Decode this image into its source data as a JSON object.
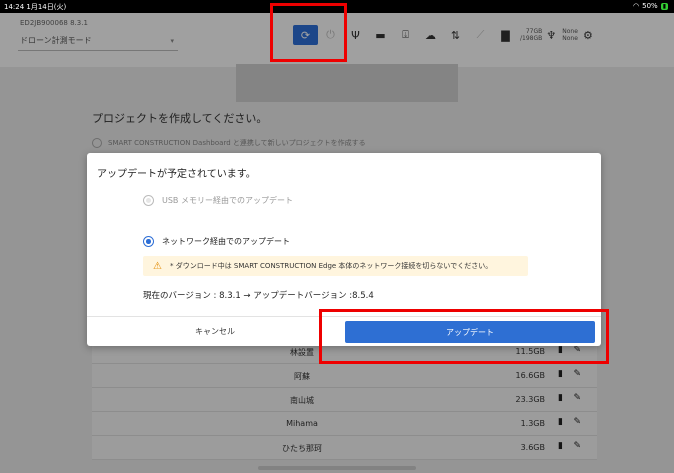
{
  "status_bar": {
    "time": "14:24  1月14日(火)",
    "dots": "•••",
    "battery": "50%"
  },
  "header": {
    "device_id": "ED2JB900068   8.3.1",
    "mode_label": "ドローン計測モード",
    "storage_used": "77GB",
    "storage_total": "/198GB",
    "none_label_1": "None",
    "none_label_2": "None"
  },
  "page": {
    "prompt": "プロジェクトを作成してください。",
    "dashboard_option": "SMART CONSTRUCTION Dashboard と連携して新しいプロジェクトを作成する"
  },
  "project_list": [
    {
      "name": "林設置",
      "size": "11.5GB"
    },
    {
      "name": "阿蘇",
      "size": "16.6GB"
    },
    {
      "name": "南山城",
      "size": "23.3GB"
    },
    {
      "name": "Mihama",
      "size": "1.3GB"
    },
    {
      "name": "ひたち那珂",
      "size": "3.6GB"
    }
  ],
  "dialog": {
    "title": "アップデートが予定されています。",
    "option_usb": "USB メモリー経由でのアップデート",
    "option_network": "ネットワーク経由でのアップデート",
    "warning": "* ダウンロード中は SMART CONSTRUCTION Edge 本体のネットワーク接続を切らないでください。",
    "version_text": "現在のバージョン : 8.3.1 → アップデートバージョン :8.5.4",
    "cancel_label": "キャンセル",
    "update_label": "アップデート"
  },
  "colors": {
    "accent": "#2e6fd3",
    "highlight": "#e00000",
    "warning_bg": "#fff5de",
    "warning_icon": "#e28a00"
  },
  "icons": [
    "refresh-icon",
    "power-icon",
    "usb-icon",
    "sd-card-icon",
    "download-icon",
    "cloud-icon",
    "transfer-icon",
    "link-icon",
    "folder-icon",
    "plug-icon",
    "gear-icon",
    "trash-icon",
    "pencil-icon",
    "warning-icon",
    "wifi-icon"
  ]
}
